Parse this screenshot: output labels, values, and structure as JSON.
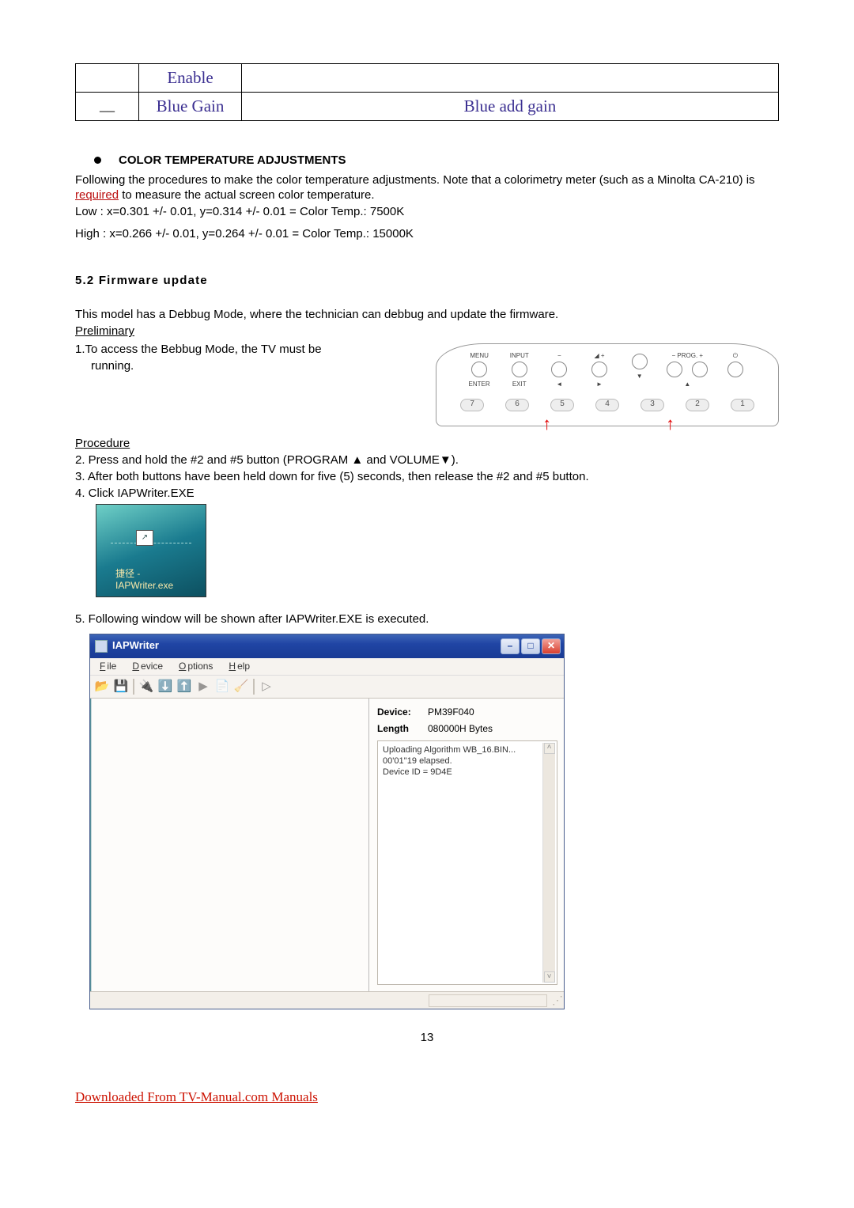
{
  "table": {
    "r1": {
      "c1": "",
      "c2": "Enable",
      "c3": ""
    },
    "r2": {
      "c1": "__",
      "c2": "Blue Gain",
      "c3": "Blue add gain"
    }
  },
  "section_bullet": "COLOR TEMPERATURE ADJUSTMENTS",
  "p1": "Following the procedures to make the color temperature adjustments. Note that a colorimetry meter (such as a Minolta CA-210) is ",
  "p1_required": "required",
  "p1_tail": " to measure the actual screen color temperature.",
  "low": "Low : x=0.301 +/- 0.01, y=0.314 +/- 0.01 = Color Temp.: 7500K",
  "high": "High : x=0.266 +/- 0.01, y=0.264 +/- 0.01 = Color Temp.: 15000K",
  "sect52": "5.2 Firmware update",
  "debbug": "This model has a Debbug Mode, where the technician can debbug and update the firmware.",
  "preliminary": "Preliminary",
  "step1_a": "1.To access the Bebbug Mode, the TV must be",
  "step1_b": "running.",
  "panel": {
    "top": [
      {
        "t": "MENU",
        "b": "ENTER"
      },
      {
        "t": "INPUT",
        "b": "EXIT"
      },
      {
        "t": "−",
        "b": "◄"
      },
      {
        "t": "◢ +",
        "b": "►"
      },
      {
        "t": "",
        "b": "▼"
      },
      {
        "t": "− PROG. +",
        "b": "▲"
      },
      {
        "t": "",
        "b": ""
      },
      {
        "t": "⏻",
        "b": ""
      }
    ],
    "nums": [
      "7",
      "6",
      "5",
      "4",
      "3",
      "2",
      "1"
    ]
  },
  "procedure": "Procedure",
  "step2": "2. Press and hold the #2 and #5 button (PROGRAM ▲ and VOLUME▼).",
  "step3": "3. After both buttons have been held down for five (5) seconds, then release the #2 and #5 button.",
  "step4": "4. Click IAPWriter.EXE",
  "iapicon": {
    "l1": "捷径 -",
    "l2": "IAPWriter.exe"
  },
  "step5": "5. Following window will be shown after IAPWriter.EXE is executed.",
  "iap": {
    "title": "IAPWriter",
    "menu": [
      "File",
      "Device",
      "Options",
      "Help"
    ],
    "info": {
      "device_k": "Device:",
      "device_v": "PM39F040",
      "length_k": "Length",
      "length_v": "080000H Bytes"
    },
    "log": [
      "Uploading Algorithm WB_16.BIN...",
      "00'01''19 elapsed.",
      "Device ID = 9D4E"
    ]
  },
  "page_num": "13",
  "footer": "Downloaded From TV-Manual.com Manuals"
}
